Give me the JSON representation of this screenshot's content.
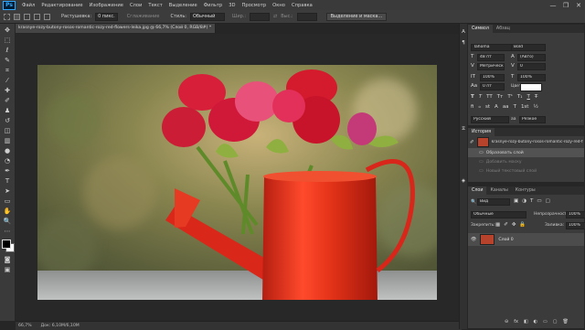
{
  "app": {
    "logo": "Ps"
  },
  "menu": {
    "items": [
      "Файл",
      "Редактирование",
      "Изображение",
      "Слои",
      "Текст",
      "Выделение",
      "Фильтр",
      "3D",
      "Просмотр",
      "Окно",
      "Справка"
    ]
  },
  "window_controls": {
    "minimize": "—",
    "maximize": "❐",
    "close": "✕"
  },
  "options_bar": {
    "feather_label": "Растушевка:",
    "feather_value": "0 пикс.",
    "smooth_label": "Сглаживание",
    "style_label": "Стиль:",
    "style_value": "Обычный",
    "width_label": "Шир.:",
    "height_label": "Выс.:",
    "mask_button": "Выделение и маска..."
  },
  "document": {
    "tab_title": "krasnye-rozy-butony-rosos-romantic-rozy-red-flowers-leika.jpg @ 66,7% (Слой 0, RGB/8#) *",
    "tab_close": "×"
  },
  "status": {
    "zoom": "66,7%",
    "doc_size": "Док: 6,10M/6,10M"
  },
  "character_panel": {
    "tabs": [
      "Символ",
      "Абзац"
    ],
    "font_family": "Tahoma",
    "font_style": "Bold",
    "font_size": "48 пт",
    "leading": "(Авто)",
    "kerning": "Метрически",
    "tracking": "0",
    "vscale": "100%",
    "hscale": "100%",
    "baseline": "0 пт",
    "color_label": "Цвет:",
    "style_buttons": [
      "T",
      "T",
      "TT",
      "Tт",
      "T¹",
      "T₁",
      "T",
      "T̶"
    ],
    "ot_buttons": [
      "fi",
      "ℴ",
      "st",
      "A",
      "aa",
      "T",
      "1st",
      "½"
    ],
    "language": "Русский",
    "antialias_icon": "aa",
    "antialias": "Резкое"
  },
  "history_panel": {
    "title": "История",
    "snapshot": "krasnye-rozy-butony-rosos-romantic-rozy-red-flowers-leika.jpg",
    "states": [
      "Образовать слой",
      "Добавить маску",
      "Новый текстовый слой"
    ]
  },
  "layers_panel": {
    "tabs": [
      "Слои",
      "Каналы",
      "Контуры"
    ],
    "filter_label": "Вид",
    "blend_mode": "Обычные",
    "opacity_label": "Непрозрачность:",
    "opacity": "100%",
    "lock_label": "Закрепить:",
    "fill_label": "Заливка:",
    "fill": "100%",
    "layers": [
      {
        "name": "Слой 0"
      }
    ],
    "footer_icons": [
      "⊖",
      "fx",
      "◧",
      "◐",
      "▭",
      "▢",
      "🗑"
    ]
  },
  "colors": {
    "accent": "#31a8ff",
    "chrome": "#3a3a3a",
    "panel": "#3b3b3b",
    "canvas": "#282828"
  }
}
